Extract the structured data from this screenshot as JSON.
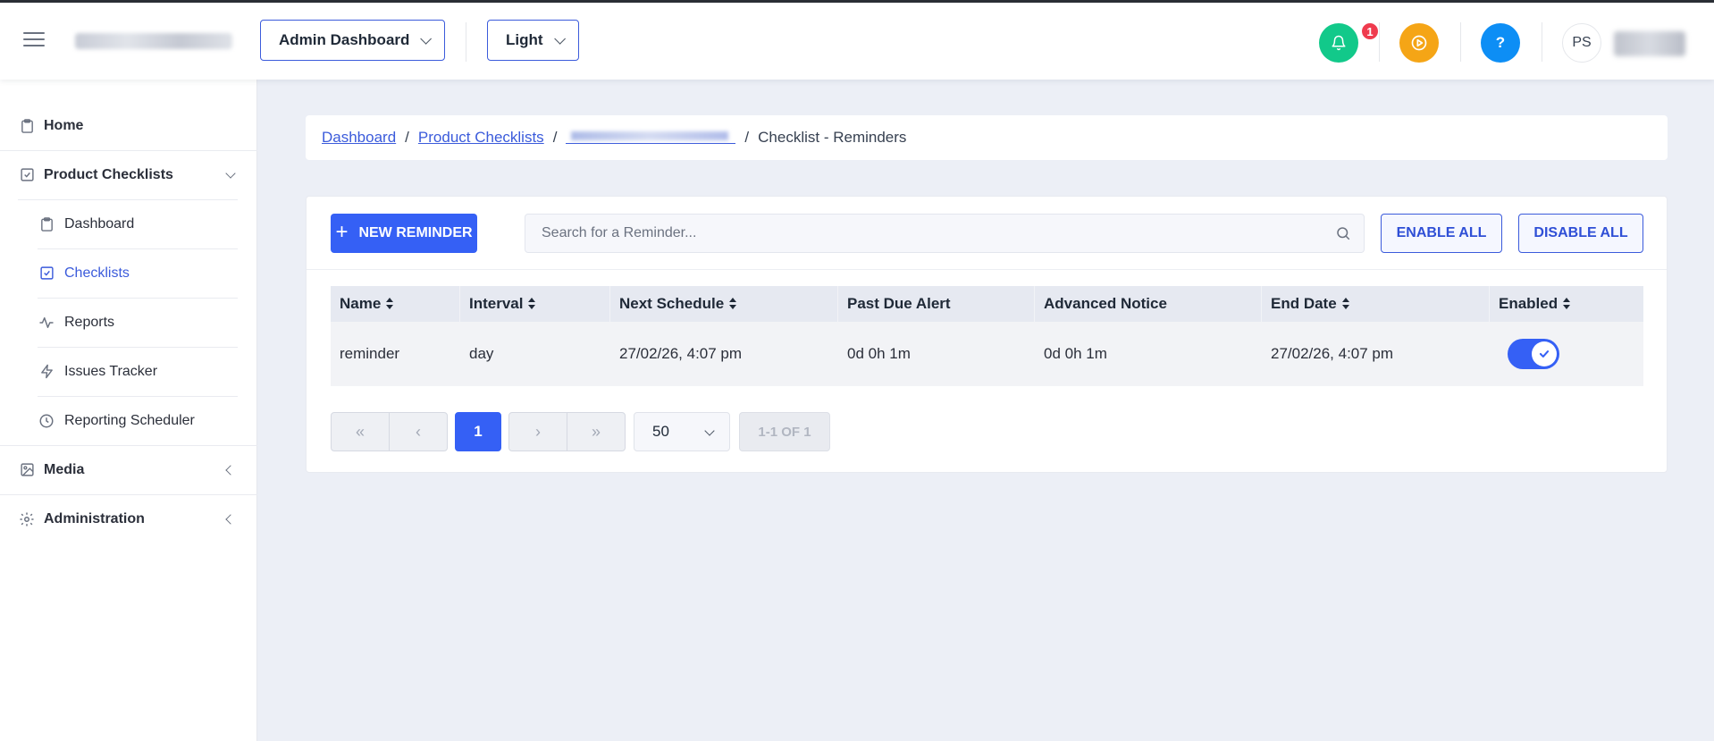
{
  "header": {
    "view_select": "Admin Dashboard",
    "theme_select": "Light",
    "notification_count": "1",
    "user_initials": "PS"
  },
  "sidebar": {
    "items": [
      {
        "label": "Home",
        "icon": "clipboard-icon"
      },
      {
        "label": "Product Checklists",
        "icon": "checkbox-icon",
        "expanded": true
      },
      {
        "label": "Dashboard",
        "icon": "clipboard-icon"
      },
      {
        "label": "Checklists",
        "icon": "checkbox-icon",
        "active": true
      },
      {
        "label": "Reports",
        "icon": "activity-icon"
      },
      {
        "label": "Issues Tracker",
        "icon": "lightning-icon"
      },
      {
        "label": "Reporting Scheduler",
        "icon": "clock-icon"
      },
      {
        "label": "Media",
        "icon": "image-icon"
      },
      {
        "label": "Administration",
        "icon": "gear-icon"
      }
    ]
  },
  "breadcrumb": {
    "items": [
      "Dashboard",
      "Product Checklists"
    ],
    "separator": "/",
    "current": "Checklist - Reminders"
  },
  "toolbar": {
    "new_label": "NEW REMINDER",
    "search_placeholder": "Search for a Reminder...",
    "enable_all": "ENABLE ALL",
    "disable_all": "DISABLE ALL"
  },
  "table": {
    "columns": [
      "Name",
      "Interval",
      "Next Schedule",
      "Past Due Alert",
      "Advanced Notice",
      "End Date",
      "Enabled"
    ],
    "rows": [
      {
        "name": "reminder",
        "interval": "day",
        "next_schedule": "27/02/26, 4:07 pm",
        "past_due_alert": "0d 0h 1m",
        "advanced_notice": "0d 0h 1m",
        "end_date": "27/02/26, 4:07 pm",
        "enabled": true
      }
    ]
  },
  "pagination": {
    "current_page": "1",
    "page_size": "50",
    "info": "1-1 OF 1"
  },
  "colors": {
    "primary": "#3560f5",
    "bell": "#12c98a",
    "play": "#f5a516",
    "help": "#0d8ef5",
    "badge": "#ef3b4e"
  }
}
